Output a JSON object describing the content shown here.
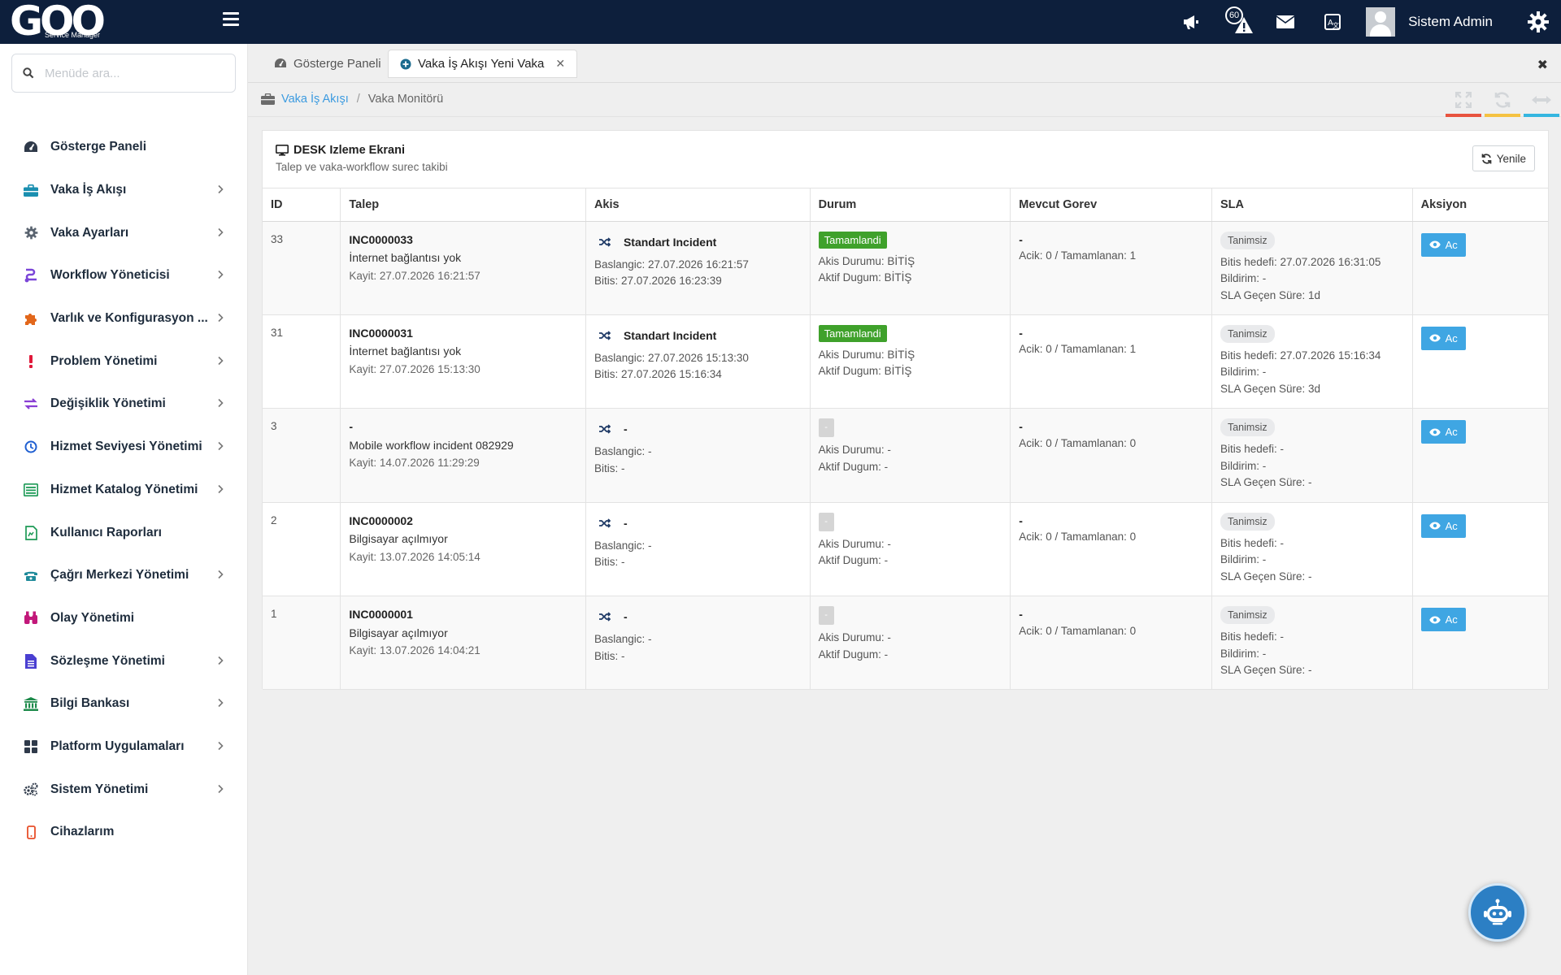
{
  "brand": {
    "logo": "GOO",
    "subtitle": "Service Manager"
  },
  "topbar": {
    "notification_count": "60",
    "user_name": "Sistem Admin",
    "icons": [
      "megaphone-icon",
      "warning-icon",
      "envelope-icon",
      "language-icon",
      "gear-icon"
    ]
  },
  "search": {
    "placeholder": "Menüde ara..."
  },
  "sidebar": {
    "items": [
      {
        "label": "Gösterge Paneli",
        "icon": "dashboard-icon",
        "color": "#2f3a4a",
        "has_sub": false
      },
      {
        "label": "Vaka İş Akışı",
        "icon": "briefcase-icon",
        "color": "#1a8fb0",
        "has_sub": true
      },
      {
        "label": "Vaka Ayarları",
        "icon": "cog-icon",
        "color": "#5a6470",
        "has_sub": true
      },
      {
        "label": "Workflow Yöneticisi",
        "icon": "workflow-icon",
        "color": "#7b45d8",
        "has_sub": true
      },
      {
        "label": "Varlık ve Konfigurasyon ...",
        "icon": "puzzle-icon",
        "color": "#e2671b",
        "has_sub": true
      },
      {
        "label": "Problem Yönetimi",
        "icon": "exclamation-icon",
        "color": "#e0193a",
        "has_sub": true
      },
      {
        "label": "Değişiklik Yönetimi",
        "icon": "exchange-icon",
        "color": "#8a3fd4",
        "has_sub": true
      },
      {
        "label": "Hizmet Seviyesi Yönetimi",
        "icon": "clock-icon",
        "color": "#1f5fd1",
        "has_sub": true
      },
      {
        "label": "Hizmet Katalog Yönetimi",
        "icon": "list-icon",
        "color": "#1d9a56",
        "has_sub": true
      },
      {
        "label": "Kullanıcı Raporları",
        "icon": "report-icon",
        "color": "#1d9a56",
        "has_sub": false
      },
      {
        "label": "Çağrı Merkezi Yönetimi",
        "icon": "phone-icon",
        "color": "#1f8a9a",
        "has_sub": true
      },
      {
        "label": "Olay Yönetimi",
        "icon": "binoculars-icon",
        "color": "#c2187a",
        "has_sub": false
      },
      {
        "label": "Sözleşme Yönetimi",
        "icon": "document-icon",
        "color": "#4a3fd1",
        "has_sub": true
      },
      {
        "label": "Bilgi Bankası",
        "icon": "bank-icon",
        "color": "#1d8a4a",
        "has_sub": true
      },
      {
        "label": "Platform Uygulamaları",
        "icon": "grid-icon",
        "color": "#2f3a4a",
        "has_sub": true
      },
      {
        "label": "Sistem Yönetimi",
        "icon": "cogs-icon",
        "color": "#2f3a4a",
        "has_sub": true
      },
      {
        "label": "Cihazlarım",
        "icon": "mobile-icon",
        "color": "#e84f2a",
        "has_sub": false
      }
    ]
  },
  "tabs": [
    {
      "label": "Gösterge Paneli",
      "active": false
    },
    {
      "label": "Vaka İş Akışı Yeni Vaka",
      "active": true
    }
  ],
  "breadcrumb": {
    "parent": "Vaka İş Akışı",
    "current": "Vaka Monitörü"
  },
  "window_tools": [
    {
      "icon": "expand-icon",
      "color": "#e8533f"
    },
    {
      "icon": "refresh-icon",
      "color": "#f5c242"
    },
    {
      "icon": "arrows-h-icon",
      "color": "#35b6e0"
    }
  ],
  "card": {
    "title": "DESK Izleme Ekrani",
    "subtitle": "Talep ve vaka-workflow surec takibi",
    "refresh_label": "Yenile"
  },
  "table": {
    "columns": [
      "ID",
      "Talep",
      "Akis",
      "Durum",
      "Mevcut Gorev",
      "SLA",
      "Aksiyon"
    ],
    "rows": [
      {
        "id": "33",
        "code": "INC0000033",
        "desc": "İnternet bağlantısı yok",
        "kayit": "Kayit: 27.07.2026 16:21:57",
        "flow": "Standart Incident",
        "baslangic": "Baslangic: 27.07.2026 16:21:57",
        "bitis": "Bitis: 27.07.2026 16:23:39",
        "status": "Tamamlandi",
        "akis_durumu": "Akis Durumu: BİTİŞ",
        "aktif_dugum": "Aktif Dugum: BİTİŞ",
        "gorev": "-",
        "gorev_stats": "Acik: 0 / Tamamlanan: 1",
        "sla_badge": "Tanimsiz",
        "sla_hedef": "Bitis hedefi: 27.07.2026 16:31:05",
        "sla_bildirim": "Bildirim: -",
        "sla_gecen": "SLA Geçen Süre: 1d",
        "action": "Ac"
      },
      {
        "id": "31",
        "code": "INC0000031",
        "desc": "İnternet bağlantısı yok",
        "kayit": "Kayit: 27.07.2026 15:13:30",
        "flow": "Standart Incident",
        "baslangic": "Baslangic: 27.07.2026 15:13:30",
        "bitis": "Bitis: 27.07.2026 15:16:34",
        "status": "Tamamlandi",
        "akis_durumu": "Akis Durumu: BİTİŞ",
        "aktif_dugum": "Aktif Dugum: BİTİŞ",
        "gorev": "-",
        "gorev_stats": "Acik: 0 / Tamamlanan: 1",
        "sla_badge": "Tanimsiz",
        "sla_hedef": "Bitis hedefi: 27.07.2026 15:16:34",
        "sla_bildirim": "Bildirim: -",
        "sla_gecen": "SLA Geçen Süre: 3d",
        "action": "Ac"
      },
      {
        "id": "3",
        "code": "-",
        "desc": "Mobile workflow incident 082929",
        "kayit": "Kayit: 14.07.2026 11:29:29",
        "flow": "-",
        "baslangic": "Baslangic: -",
        "bitis": "Bitis: -",
        "status": "-",
        "akis_durumu": "Akis Durumu: -",
        "aktif_dugum": "Aktif Dugum: -",
        "gorev": "-",
        "gorev_stats": "Acik: 0 / Tamamlanan: 0",
        "sla_badge": "Tanimsiz",
        "sla_hedef": "Bitis hedefi: -",
        "sla_bildirim": "Bildirim: -",
        "sla_gecen": "SLA Geçen Süre: -",
        "action": "Ac"
      },
      {
        "id": "2",
        "code": "INC0000002",
        "desc": "Bilgisayar açılmıyor",
        "kayit": "Kayit: 13.07.2026 14:05:14",
        "flow": "-",
        "baslangic": "Baslangic: -",
        "bitis": "Bitis: -",
        "status": "-",
        "akis_durumu": "Akis Durumu: -",
        "aktif_dugum": "Aktif Dugum: -",
        "gorev": "-",
        "gorev_stats": "Acik: 0 / Tamamlanan: 0",
        "sla_badge": "Tanimsiz",
        "sla_hedef": "Bitis hedefi: -",
        "sla_bildirim": "Bildirim: -",
        "sla_gecen": "SLA Geçen Süre: -",
        "action": "Ac"
      },
      {
        "id": "1",
        "code": "INC0000001",
        "desc": "Bilgisayar açılmıyor",
        "kayit": "Kayit: 13.07.2026 14:04:21",
        "flow": "-",
        "baslangic": "Baslangic: -",
        "bitis": "Bitis: -",
        "status": "-",
        "akis_durumu": "Akis Durumu: -",
        "aktif_dugum": "Aktif Dugum: -",
        "gorev": "-",
        "gorev_stats": "Acik: 0 / Tamamlanan: 0",
        "sla_badge": "Tanimsiz",
        "sla_hedef": "Bitis hedefi: -",
        "sla_bildirim": "Bildirim: -",
        "sla_gecen": "SLA Geçen Süre: -",
        "action": "Ac"
      }
    ]
  },
  "colors": {
    "topbar": "#0d1f3c",
    "link": "#3c9be0",
    "success": "#3fa12b",
    "action": "#3fa6e3"
  }
}
